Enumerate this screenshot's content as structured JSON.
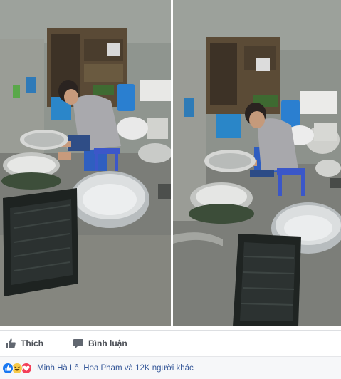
{
  "post": {
    "photos": [
      {
        "name": "photo-left",
        "subject": "young man in grey t-shirt washing dishes on a stool"
      },
      {
        "name": "photo-right",
        "subject": "same man washing dishes, different angle"
      }
    ],
    "actions": {
      "like_label": "Thích",
      "comment_label": "Bình luận"
    },
    "reactions": {
      "icons": [
        "like-reaction-icon",
        "haha-reaction-icon",
        "love-reaction-icon"
      ],
      "summary": "Minh Hà Lê, Hoa Pham và 12K người khác"
    }
  },
  "colors": {
    "link": "#365899",
    "action_text": "#4b4f56",
    "like_blue": "#1877f2",
    "love_red": "#f33e58",
    "haha_yellow": "#f7c948"
  }
}
